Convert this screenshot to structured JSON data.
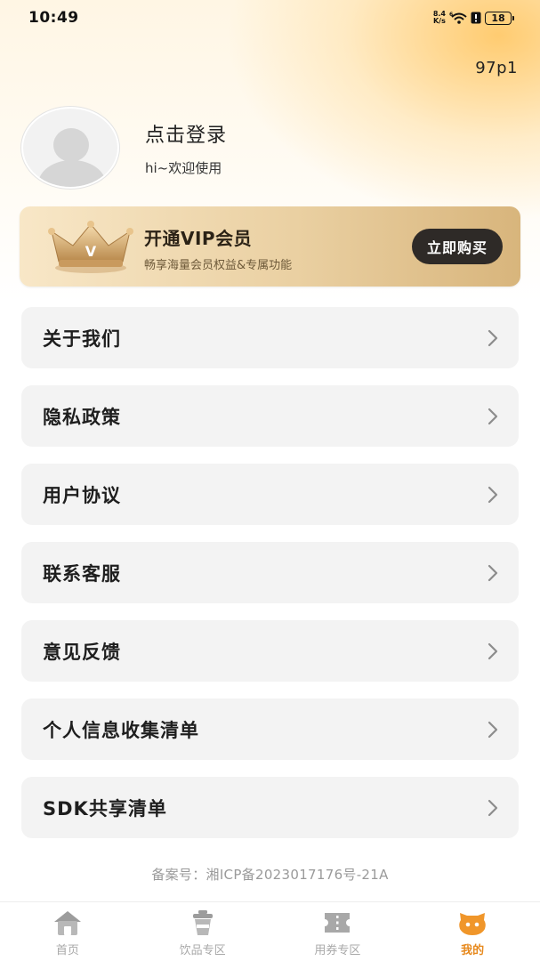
{
  "status_bar": {
    "time": "10:49",
    "net_speed_value": "8.4",
    "net_speed_unit": "K/s",
    "battery": "18"
  },
  "version": "97p1",
  "profile": {
    "login_text": "点击登录",
    "welcome_text": "hi~欢迎使用"
  },
  "vip": {
    "title": "开通VIP会员",
    "subtitle": "畅享海量会员权益&专属功能",
    "buy_label": "立即购买",
    "crown_letter": "V"
  },
  "menu": [
    {
      "label": "关于我们"
    },
    {
      "label": "隐私政策"
    },
    {
      "label": "用户协议"
    },
    {
      "label": "联系客服"
    },
    {
      "label": "意见反馈"
    },
    {
      "label": "个人信息收集清单"
    },
    {
      "label": "SDK共享清单"
    }
  ],
  "icp": "备案号：湘ICP备2023017176号-21A",
  "tabs": [
    {
      "label": "首页",
      "icon": "home-icon",
      "active": false
    },
    {
      "label": "饮品专区",
      "icon": "drink-cup-icon",
      "active": false
    },
    {
      "label": "用券专区",
      "icon": "coupon-icon",
      "active": false
    },
    {
      "label": "我的",
      "icon": "profile-face-icon",
      "active": true
    }
  ],
  "colors": {
    "accent": "#e78a1f",
    "vip_button": "#2e2a27",
    "menu_bg": "#f3f3f3",
    "tab_inactive": "#a8a8a8"
  }
}
